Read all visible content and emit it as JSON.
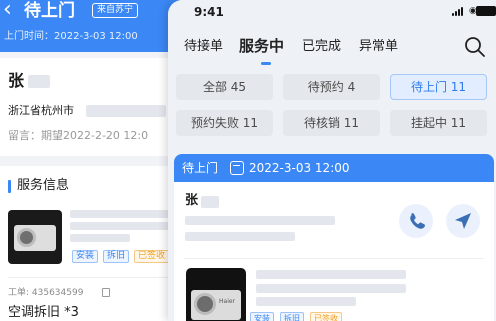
{
  "background_screen": {
    "back_icon": "‹",
    "title": "待上门",
    "source_tag": "来自苏宁",
    "visit_time": "上门时间：2022-3-03 12:00",
    "customer_name": "张",
    "address": "浙江省杭州市",
    "note": "留言：期望2022-2-20 12:0",
    "section_title": "服务信息",
    "tags": [
      "安装",
      "拆旧",
      "已签收"
    ],
    "order_no": "工单: 435634599",
    "service_type": "空调拆旧 *3",
    "colors": {
      "primary": "#3a87f5",
      "tag_blue": "#3a87f5",
      "tag_orange": "#f0a020"
    }
  },
  "status_bar": {
    "time": "9:41",
    "icons": [
      "signal-icon",
      "wifi-icon",
      "battery-icon"
    ]
  },
  "tabs": [
    {
      "label": "待接单",
      "active": false
    },
    {
      "label": "服务中",
      "active": true
    },
    {
      "label": "已完成",
      "active": false
    },
    {
      "label": "异常单",
      "active": false
    }
  ],
  "filters": [
    {
      "label": "全部 45",
      "selected": false
    },
    {
      "label": "待预约 4",
      "selected": false
    },
    {
      "label": "待上门 11",
      "selected": true
    },
    {
      "label": "预约失败 11",
      "selected": false
    },
    {
      "label": "待核销 11",
      "selected": false
    },
    {
      "label": "挂起中 11",
      "selected": false
    }
  ],
  "order_card": {
    "status": "待上门",
    "time": "2022-3-03 12:00",
    "customer_name": "张",
    "tags": [
      "安装",
      "拆旧",
      "已签收"
    ],
    "actions": [
      "phone-icon",
      "navigate-icon"
    ]
  }
}
